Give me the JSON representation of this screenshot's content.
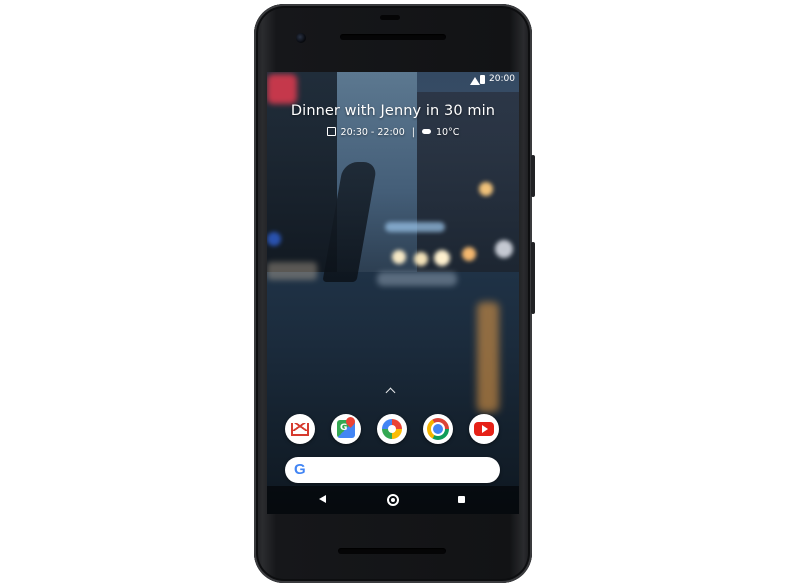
{
  "status_bar": {
    "time": "20:00"
  },
  "glance": {
    "title": "Dinner with Jenny in 30 min",
    "time_range": "20:30 - 22:00",
    "separator": "|",
    "temperature": "10°C"
  },
  "dock": {
    "apps": [
      {
        "name": "Gmail",
        "icon": "gmail-icon"
      },
      {
        "name": "Maps",
        "icon": "maps-icon"
      },
      {
        "name": "Photos",
        "icon": "photos-icon"
      },
      {
        "name": "Chrome",
        "icon": "chrome-icon"
      },
      {
        "name": "YouTube",
        "icon": "youtube-icon"
      }
    ]
  },
  "search": {
    "logo": "G",
    "logo_icon": "google-g-icon"
  },
  "nav": {
    "back_icon": "back-icon",
    "home_icon": "home-icon",
    "recents_icon": "recents-icon"
  },
  "colors": {
    "phone_body": "#141518",
    "gmail_red": "#d63b2f",
    "google_blue": "#4285f4",
    "google_red": "#ea4335",
    "google_yellow": "#fbbc05",
    "google_green": "#34a853",
    "youtube_red": "#e62117"
  }
}
